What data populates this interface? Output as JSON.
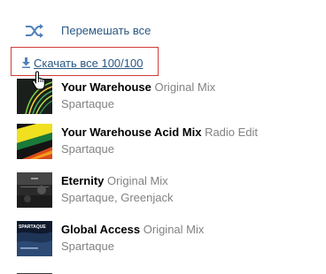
{
  "shuffle": {
    "label": "Перемешать все",
    "icon": "shuffle-icon"
  },
  "download": {
    "label": "Скачать все 100/100",
    "icon": "download-icon",
    "highlight_color": "#d23a3a"
  },
  "tracks": [
    {
      "title": "Your Warehouse",
      "version": "Original Mix",
      "artist": "Spartaque"
    },
    {
      "title": "Your Warehouse Acid Mix",
      "version": "Radio Edit",
      "artist": "Spartaque"
    },
    {
      "title": "Eternity",
      "version": "Original Mix",
      "artist": "Spartaque, Greenjack"
    },
    {
      "title": "Global Access",
      "version": "Original Mix",
      "artist": "Spartaque",
      "cover_text": "SPARTAQUE"
    }
  ],
  "colors": {
    "link": "#2a5885",
    "secondary": "#828282",
    "title": "#000000"
  }
}
